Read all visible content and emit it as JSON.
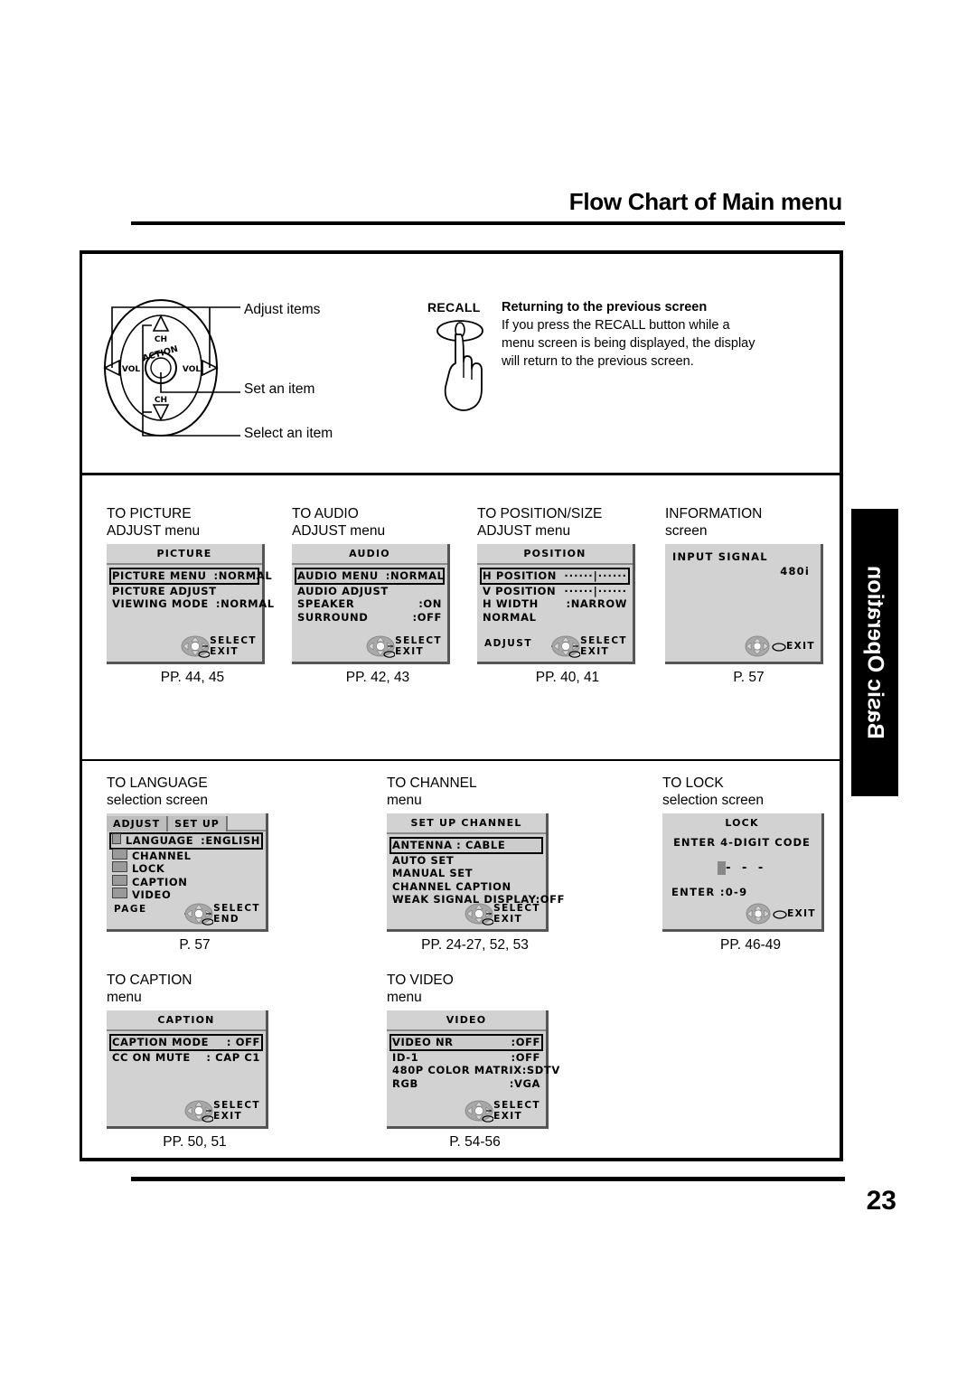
{
  "header": {
    "title": "Flow Chart of Main menu"
  },
  "side_tab": {
    "label": "Basic Operation"
  },
  "page_number": "23",
  "remote": {
    "labels": {
      "ch_up": "CH",
      "ch_down": "CH",
      "vol_left": "VOL",
      "vol_right": "VOL",
      "action": "ACTION"
    },
    "callouts": {
      "adjust": "Adjust items",
      "set": "Set an item",
      "select": "Select an item"
    }
  },
  "recall": {
    "button_label": "RECALL",
    "heading": "Returning to the previous screen",
    "lines": [
      "If you press the RECALL button while a",
      "menu screen is being displayed, the display",
      "will return to the previous screen."
    ]
  },
  "cells": {
    "picture": {
      "title": "TO PICTURE",
      "subtitle": "ADJUST menu",
      "page_ref": "PP. 44, 45",
      "screen": {
        "title": "PICTURE",
        "rows": [
          {
            "label": "PICTURE MENU",
            "value": ":NORMAL",
            "selected": true
          },
          {
            "label": "PICTURE ADJUST",
            "value": "",
            "selected": false
          },
          {
            "label": "VIEWING MODE",
            "value": ":NORMAL",
            "selected": false
          }
        ],
        "nav": {
          "select": "SELECT",
          "exit": "EXIT"
        }
      }
    },
    "audio": {
      "title": "TO AUDIO",
      "subtitle": "ADJUST menu",
      "page_ref": "PP. 42, 43",
      "screen": {
        "title": "AUDIO",
        "rows": [
          {
            "label": "AUDIO MENU",
            "value": ":NORMAL",
            "selected": true
          },
          {
            "label": "AUDIO ADJUST",
            "value": "",
            "selected": false
          },
          {
            "label": "SPEAKER",
            "value": ":ON",
            "selected": false
          },
          {
            "label": "SURROUND",
            "value": ":OFF",
            "selected": false
          }
        ],
        "nav": {
          "select": "SELECT",
          "exit": "EXIT"
        }
      }
    },
    "position": {
      "title": "TO POSITION/SIZE",
      "subtitle": "ADJUST menu",
      "page_ref": "PP. 40, 41",
      "screen": {
        "title": "POSITION",
        "rows": [
          {
            "label": "H POSITION",
            "value": "······|······",
            "selected": true
          },
          {
            "label": "V POSITION",
            "value": "······|······",
            "selected": false
          },
          {
            "label": "H WIDTH",
            "value": ":NARROW",
            "selected": false
          },
          {
            "label": "NORMAL",
            "value": "",
            "selected": false
          }
        ],
        "nav": {
          "adjust": "ADJUST",
          "select": "SELECT",
          "exit": "EXIT"
        }
      }
    },
    "information": {
      "title": "INFORMATION",
      "subtitle": "screen",
      "page_ref": "P. 57",
      "screen": {
        "title": "INPUT SIGNAL",
        "value": "480i",
        "nav": {
          "exit": "EXIT"
        }
      }
    },
    "language": {
      "title": "TO LANGUAGE",
      "subtitle": "selection screen",
      "page_ref": "P. 57",
      "screen": {
        "tabs": [
          "ADJUST",
          "SET UP"
        ],
        "rows": [
          {
            "icon": "language-icon",
            "label": "LANGUAGE",
            "value": ":ENGLISH",
            "selected": true
          },
          {
            "icon": "channel-icon",
            "label": "CHANNEL",
            "value": "",
            "selected": false
          },
          {
            "icon": "lock-icon",
            "label": "LOCK",
            "value": "",
            "selected": false
          },
          {
            "icon": "caption-icon",
            "label": "CAPTION",
            "value": "",
            "selected": false
          },
          {
            "icon": "video-icon",
            "label": "VIDEO",
            "value": "",
            "selected": false
          }
        ],
        "nav": {
          "page": "PAGE",
          "select": "SELECT",
          "end": "END"
        }
      }
    },
    "channel": {
      "title": "TO CHANNEL",
      "subtitle": "menu",
      "page_ref": "PP. 24-27, 52, 53",
      "screen": {
        "title": "SET UP CHANNEL",
        "rows": [
          {
            "label": "ANTENNA : CABLE",
            "value": "",
            "selected": true
          },
          {
            "label": "AUTO SET",
            "value": "",
            "selected": false
          },
          {
            "label": "MANUAL SET",
            "value": "",
            "selected": false
          },
          {
            "label": "CHANNEL CAPTION",
            "value": "",
            "selected": false
          },
          {
            "label": "WEAK SIGNAL DISPLAY:OFF",
            "value": "",
            "selected": false
          }
        ],
        "nav": {
          "select": "SELECT",
          "exit": "EXIT"
        }
      }
    },
    "lock": {
      "title": "TO LOCK",
      "subtitle": "selection screen",
      "page_ref": "PP. 46-49",
      "screen": {
        "title": "LOCK",
        "prompt": "ENTER 4-DIGIT CODE",
        "code_cursor": "-",
        "code_rest": "- - -",
        "enter_label": "ENTER :0-9",
        "nav": {
          "exit": "EXIT"
        }
      }
    },
    "caption": {
      "title": "TO CAPTION",
      "subtitle": "menu",
      "page_ref": "PP. 50, 51",
      "screen": {
        "title": "CAPTION",
        "rows": [
          {
            "label": "CAPTION MODE",
            "value": ": OFF",
            "selected": true
          },
          {
            "label": "CC ON MUTE",
            "value": ": CAP C1",
            "selected": false
          }
        ],
        "nav": {
          "select": "SELECT",
          "exit": "EXIT"
        }
      }
    },
    "video": {
      "title": "TO VIDEO",
      "subtitle": "menu",
      "page_ref": "P. 54-56",
      "screen": {
        "title": "VIDEO",
        "rows": [
          {
            "label": "VIDEO NR",
            "value": ":OFF",
            "selected": true
          },
          {
            "label": "ID-1",
            "value": ":OFF",
            "selected": false
          },
          {
            "label": "480P COLOR MATRIX",
            "value": ":SDTV",
            "selected": false
          },
          {
            "label": "RGB",
            "value": ":VGA",
            "selected": false
          }
        ],
        "nav": {
          "select": "SELECT",
          "exit": "EXIT"
        }
      }
    }
  }
}
